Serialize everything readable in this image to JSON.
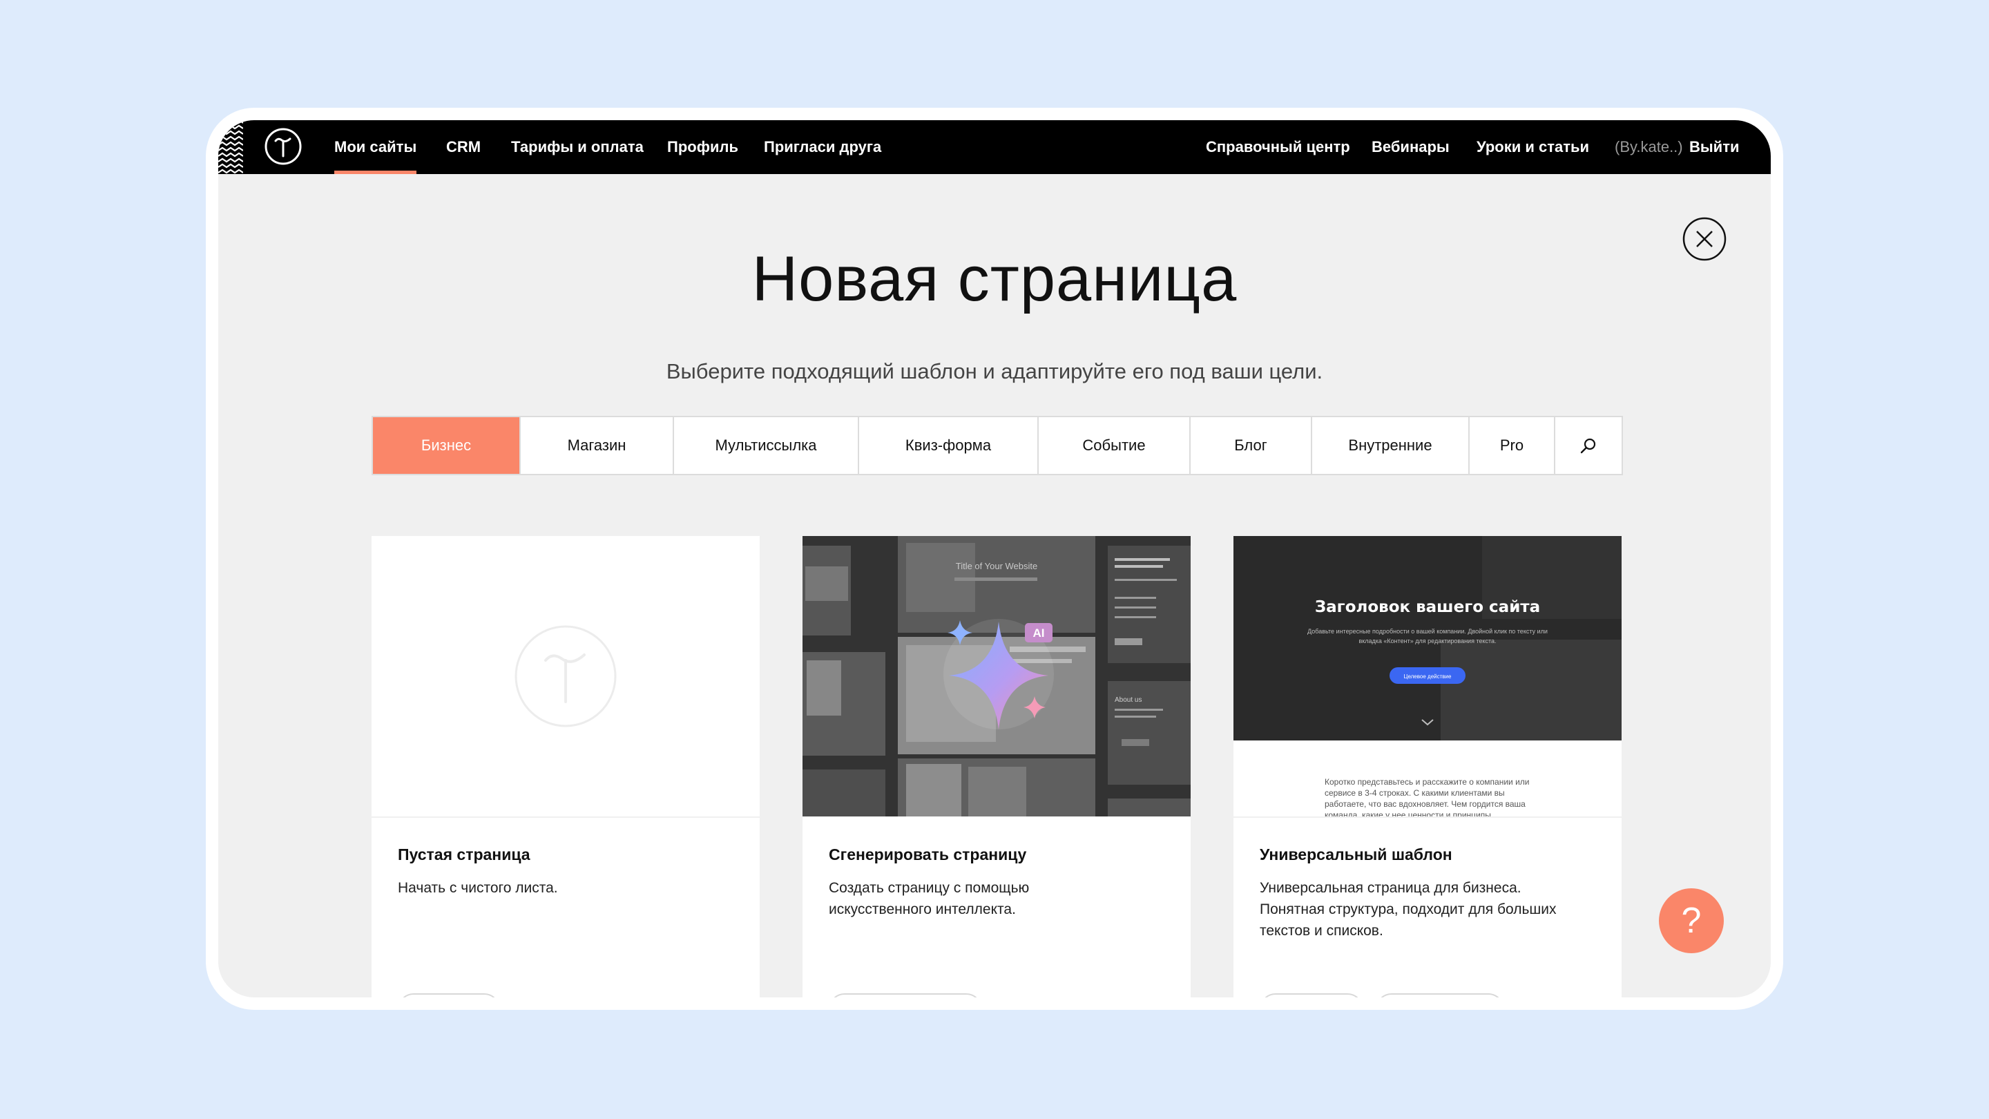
{
  "topbar": {
    "logo_icon": "tilda-logo-icon",
    "nav_left": [
      "Мои сайты",
      "CRM",
      "Тарифы и оплата",
      "Профиль",
      "Пригласи друга"
    ],
    "nav_right": [
      "Справочный центр",
      "Вебинары",
      "Уроки и статьи"
    ],
    "user": "(By.kate..)",
    "logout": "Выйти"
  },
  "modal": {
    "title": "Новая страница",
    "subtitle": "Выберите подходящий шаблон и адаптируйте его под ваши цели.",
    "tabs": [
      "Бизнес",
      "Магазин",
      "Мультиссылка",
      "Квиз-форма",
      "Событие",
      "Блог",
      "Внутренние",
      "Pro"
    ],
    "search_icon": "search-icon",
    "close_icon": "close-icon"
  },
  "cards": [
    {
      "title": "Пустая страница",
      "desc": [
        "Начать с чистого листа."
      ]
    },
    {
      "title": "Сгенерировать страницу",
      "desc": [
        "Создать страницу с помощью",
        "искусственного интеллекта."
      ],
      "preview": {
        "site_title": "Title of Your Website",
        "ai_badge": "AI",
        "about": "About us"
      }
    },
    {
      "title": "Универсальный шаблон",
      "desc": [
        "Универсальная страница для бизнеса.",
        "Понятная структура, подходит для больших",
        "текстов и списков."
      ],
      "preview": {
        "heading": "Заголовок вашего сайта",
        "sub1": "Добавьте интересные подробности о вашей компании. Двойной клик по тексту или",
        "sub2": "вкладка «Контент» для редактирования текста.",
        "button": "Целевое действие",
        "body1": "Коротко представьтесь и расскажите о компании или",
        "body2": "сервисе в 3-4 строках. С какими клиентами вы",
        "body3": "работаете, что вас вдохновляет. Чем гордится ваша",
        "body4": "команда, какие у нее ценности и принципы."
      }
    }
  ],
  "help": {
    "label": "?"
  },
  "colors": {
    "accent": "#fa8669",
    "background": "#deebfc",
    "bar": "#000000"
  }
}
